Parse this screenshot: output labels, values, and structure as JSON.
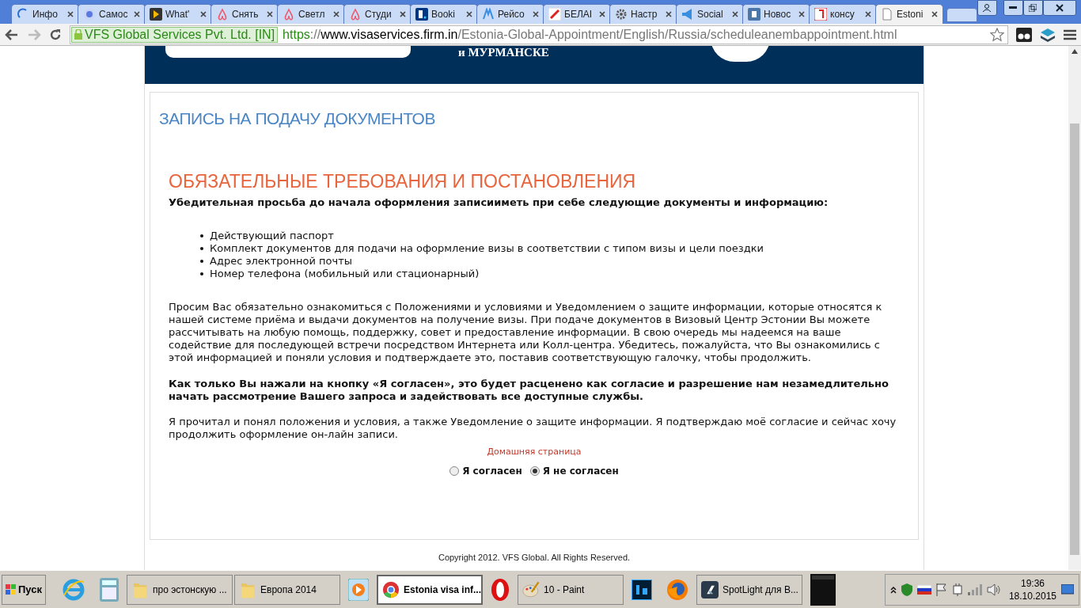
{
  "tabs": [
    {
      "label": "Инфо",
      "selected": false
    },
    {
      "label": "Самос",
      "selected": false
    },
    {
      "label": "What'",
      "selected": false
    },
    {
      "label": "Снять",
      "selected": false
    },
    {
      "label": "Светл",
      "selected": false
    },
    {
      "label": "Студи",
      "selected": false
    },
    {
      "label": "Booki",
      "selected": false
    },
    {
      "label": "Рейсо",
      "selected": false
    },
    {
      "label": "БЕЛАI",
      "selected": false
    },
    {
      "label": "Настр",
      "selected": false
    },
    {
      "label": "Social",
      "selected": false
    },
    {
      "label": "Новос",
      "selected": false
    },
    {
      "label": "консу",
      "selected": false
    },
    {
      "label": "Estoni",
      "selected": true
    }
  ],
  "address_bar": {
    "certificate": "VFS Global Services Pvt. Ltd. [IN]",
    "scheme": "https",
    "separator": "://",
    "host": "www.visaservices.firm.in",
    "path": "/Estonia-Global-Appointment/English/Russia/scheduleanembappointment.html"
  },
  "banner": {
    "city_text": "и МУРМАНСКЕ"
  },
  "page_title": "ЗАПИСЬ НА ПОДАЧУ ДОКУМЕНТОВ",
  "section_heading": "ОБЯЗАТЕЛЬНЫЕ ТРЕБОВАНИЯ И ПОСТАНОВЛЕНИЯ",
  "intro": "Убедительная просьба до начала оформления записииметь при себе следующие документы и информацию:",
  "requirements": [
    "Действующий паспорт",
    "Комплект документов для подачи на оформление визы в соответствии с типом визы и цели поездки",
    "Адрес электронной почты",
    "Номер телефона (мобильный или стационарный)"
  ],
  "paragraph": "Просим Вас обязательно ознакомиться с Положениями и условиями и Уведомлением о защите информации, которые относятся к нашей системе приёма и выдачи документов на получение визы. При подаче документов в Визовый Центр Эстонии Вы можете рассчитывать на любую помощь, поддержку, совет и предоставление информации. В свою очередь мы надеемся на ваше содействие для последующей встречи посредством Интернета или Колл-центра. Убедитесь, пожалуйста, что Вы ознакомились с этой информацией и поняли условия и подтверждаете это, поставив соответствующую галочку, чтобы продолжить.",
  "notice": "Как только Вы нажали на кнопку «Я согласен», это будет расценено как согласие и разрешение нам незамедлительно начать рассмотрение Вашего запроса и задействовать все доступные службы.",
  "confirmation": "Я прочитал и понял положения и условия, а также Уведомление о защите информации. Я подтверждаю моё согласие и сейчас хочу продолжить оформление он-лайн записи.",
  "home_link": "Домашняя страница",
  "consent_options": [
    {
      "label": "Я согласен",
      "selected": false
    },
    {
      "label": "Я не согласен",
      "selected": true
    }
  ],
  "footer": "Copyright 2012. VFS Global. All Rights Reserved.",
  "taskbar": {
    "start": "Пуск",
    "items": [
      {
        "kind": "icon"
      },
      {
        "kind": "icon"
      },
      {
        "kind": "button",
        "label": "про эстонскую ...",
        "selected": false
      },
      {
        "kind": "button",
        "label": "Европа 2014",
        "selected": false
      },
      {
        "kind": "icon"
      },
      {
        "kind": "button",
        "label": "Estonia visa inf...",
        "selected": true
      },
      {
        "kind": "icon"
      },
      {
        "kind": "button",
        "label": "10 - Paint",
        "selected": false
      },
      {
        "kind": "icon"
      },
      {
        "kind": "icon"
      },
      {
        "kind": "button",
        "label": "SpotLight для В...",
        "selected": false
      },
      {
        "kind": "icon"
      }
    ],
    "time": "19:36",
    "date": "18.10.2015"
  }
}
